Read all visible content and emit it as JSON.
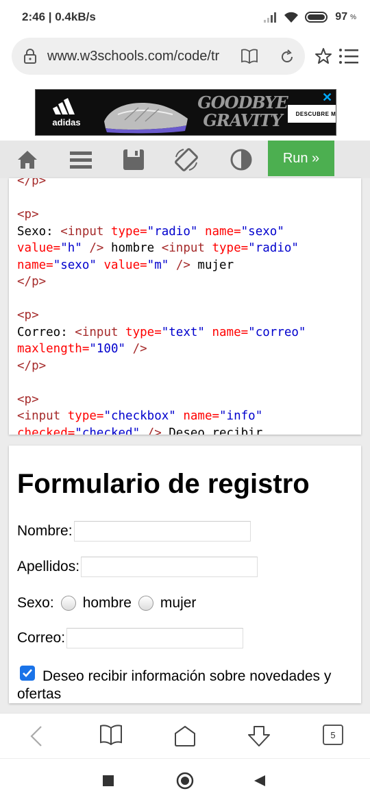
{
  "status": {
    "time": "2:46 | 0.4kB/s",
    "battery": "97",
    "battery_pct": "%"
  },
  "browser": {
    "url": "www.w3schools.com/code/tr",
    "tab_count": "5"
  },
  "ad": {
    "brand": "adidas",
    "headline_1": "GOODBYE",
    "headline_2": "GRAVITY",
    "cta": "DESCUBRE MÁS"
  },
  "toolbar": {
    "run_label": "Run »"
  },
  "code": {
    "l0": "</p>",
    "l2": "<p>",
    "l3a": "Sexo: ",
    "l3b": "<input",
    "l3c": " type=",
    "l3d": "\"radio\"",
    "l3e": " name=",
    "l3f": "\"sexo\"",
    "l4a": "value=",
    "l4b": "\"h\"",
    "l4c": " />",
    "l4d": " hombre ",
    "l4e": "<input",
    "l4f": " type=",
    "l4g": "\"radio\"",
    "l5a": "name=",
    "l5b": "\"sexo\"",
    "l5c": " value=",
    "l5d": "\"m\"",
    "l5e": " />",
    "l5f": " mujer",
    "l6": "</p>",
    "l8": "<p>",
    "l9a": "Correo: ",
    "l9b": "<input",
    "l9c": " type=",
    "l9d": "\"text\"",
    "l9e": " name=",
    "l9f": "\"correo\"",
    "l10a": "maxlength=",
    "l10b": "\"100\"",
    "l10c": " />",
    "l11": "</p>",
    "l13": "<p>",
    "l14a": "<input",
    "l14b": " type=",
    "l14c": "\"checkbox\"",
    "l14d": " name=",
    "l14e": "\"info\"",
    "l15a": "checked=",
    "l15b": "\"checked\"",
    "l15c": " />",
    "l15d": " Deseo recibir"
  },
  "result": {
    "title": "Formulario de registro",
    "nombre_label": "Nombre:",
    "apellidos_label": "Apellidos:",
    "sexo_label": "Sexo:",
    "hombre_label": "hombre",
    "mujer_label": "mujer",
    "correo_label": "Correo:",
    "info_label": "Deseo recibir información sobre novedades y ofertas"
  },
  "colors": {
    "run": "#4caf50",
    "tag": "#a52a2a",
    "attr": "#ff0000",
    "value": "#0000cd"
  }
}
